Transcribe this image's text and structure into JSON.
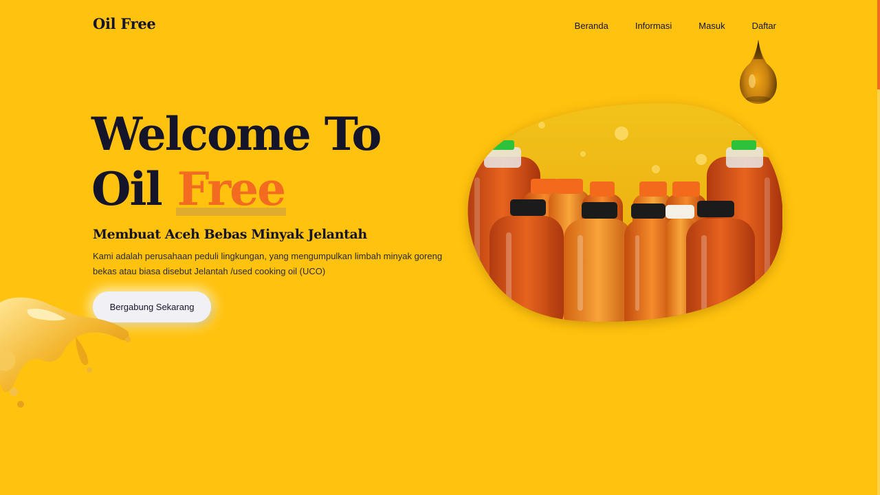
{
  "header": {
    "logo": "Oil Free",
    "nav": [
      "Beranda",
      "Informasi",
      "Masuk",
      "Daftar"
    ]
  },
  "hero": {
    "title_line1": "Welcome To",
    "title_line2_prefix": "Oil",
    "title_line2_accent": "Free",
    "subtitle": "Membuat Aceh Bebas Minyak Jelantah",
    "description": "Kami adalah perusahaan peduli lingkungan, yang mengumpulkan limbah minyak goreng bekas atau biasa disebut Jelantah /used cooking oil (UCO)",
    "cta_label": "Bergabung Sekarang"
  },
  "icons": {
    "drop": "oil-drop-icon",
    "splash": "oil-splash-image",
    "bottles": "oil-bottles-image"
  },
  "colors": {
    "background": "#FFC20E",
    "accent": "#F26B21",
    "text": "#14142B",
    "button": "#F1F1F5"
  }
}
